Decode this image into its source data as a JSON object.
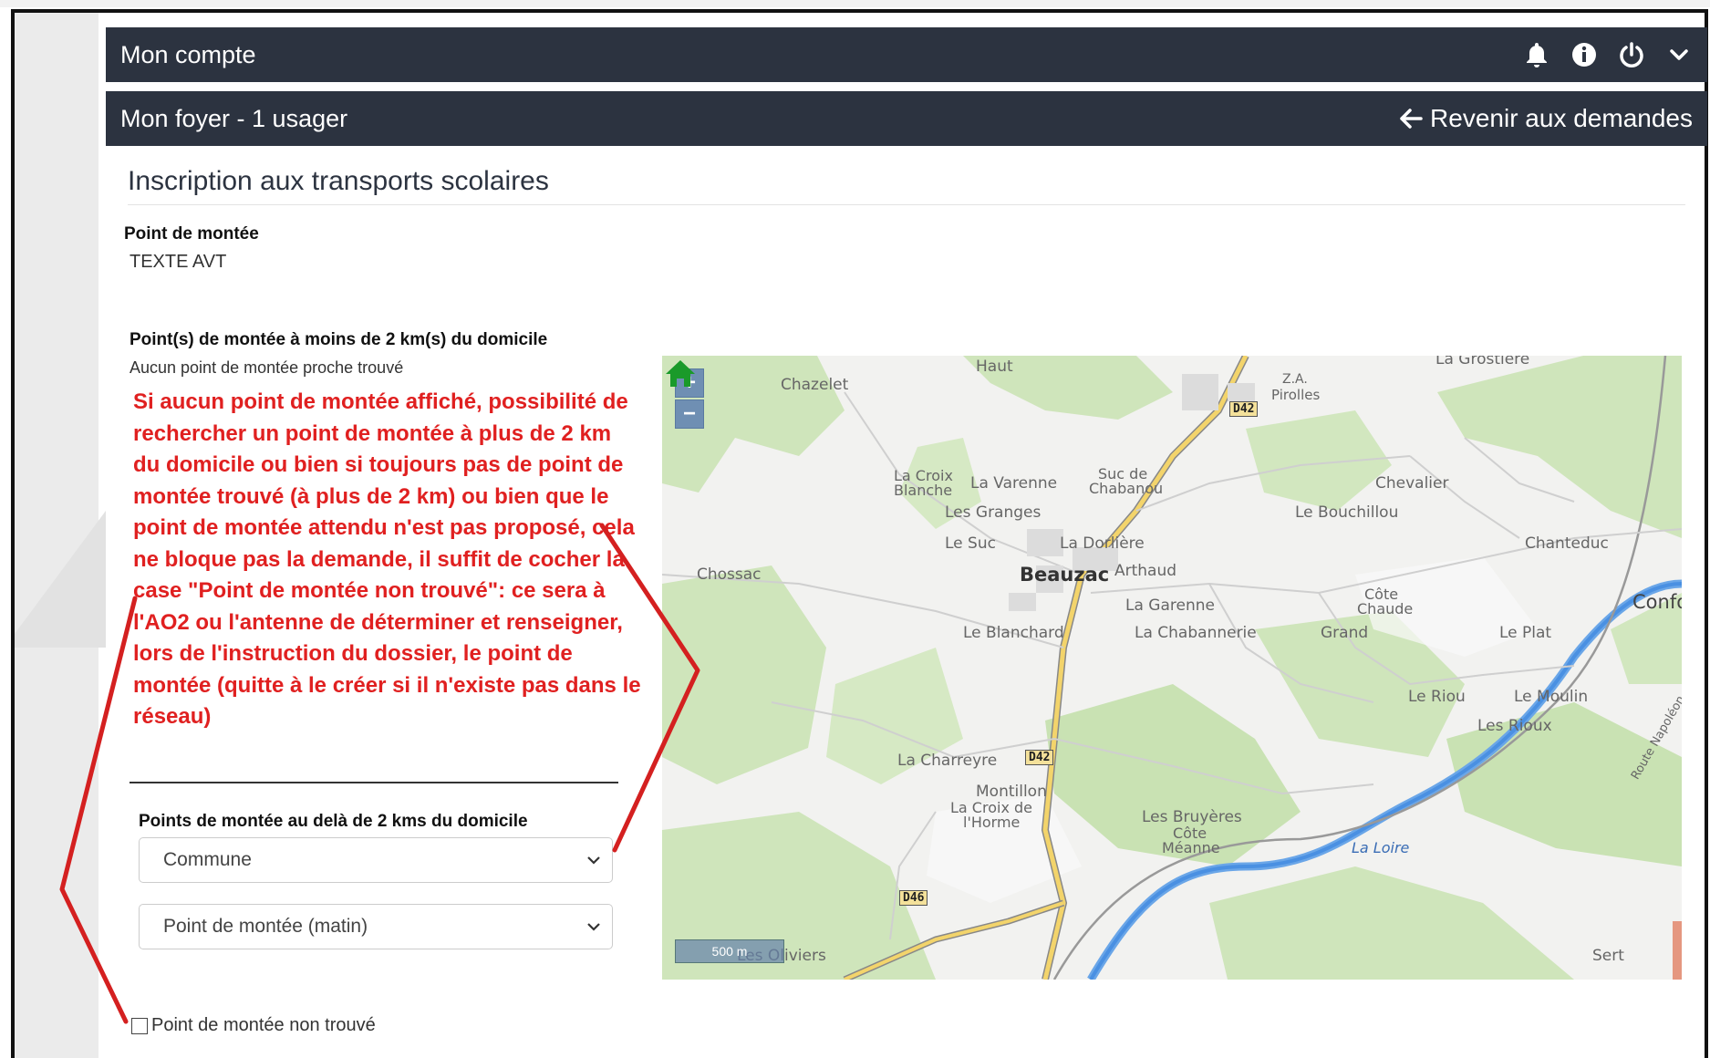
{
  "topbar": {
    "title": "Mon compte",
    "icons": [
      "bell-icon",
      "info-icon",
      "power-icon",
      "chevron-down-icon"
    ]
  },
  "subbar": {
    "title": "Mon foyer - 1 usager",
    "back_label": "Revenir aux demandes"
  },
  "page": {
    "heading": "Inscription aux transports scolaires",
    "pickup_label": "Point de montée",
    "pickup_value": "TEXTE AVT",
    "nearby_title": "Point(s) de montée à moins de 2 km(s) du domicile",
    "nearby_empty": "Aucun point de montée proche trouvé",
    "annotation": "Si aucun point de montée affiché, possibilité de rechercher un point de montée à plus de 2 km du domicile ou bien si toujours pas de point de montée trouvé (à plus de 2 km) ou bien que le point de montée attendu n'est pas proposé, cela ne bloque pas la demande, il suffit de cocher la case \"Point de montée non trouvé\": ce sera à l'AO2 ou l'antenne de déterminer et renseigner, lors de l'instruction du dossier, le point de montée (quitte à le créer si il n'existe pas dans le réseau)",
    "far_title": "Points de montée au delà de 2 kms du domicile",
    "select_commune": "Commune",
    "select_point": "Point de montée (matin)",
    "not_found_label": "Point de montée non trouvé"
  },
  "map": {
    "zoom_in": "+",
    "zoom_out": "−",
    "scale": "500 m",
    "places": {
      "haut": "Haut",
      "chazelet": "Chazelet",
      "grostiere": "La Grostière",
      "za": "Z.A.",
      "pirolles": "Pirolles",
      "croix1": "La Croix",
      "blanche": "Blanche",
      "varenne": "La Varenne",
      "suc": "Suc de",
      "chabanou": "Chabanou",
      "chevalier": "Chevalier",
      "granges": "Les Granges",
      "bouchillou": "Le Bouchillou",
      "lesuc": "Le Suc",
      "dorliere": "La Dorlière",
      "chanteduc": "Chanteduc",
      "chossac": "Chossac",
      "beauzac": "Beauzac",
      "arthaud": "Arthaud",
      "garenne": "La Garenne",
      "cote": "Côte",
      "chaude": "Chaude",
      "confo": "Confo",
      "blanchard": "Le Blanchard",
      "chabannerie": "La Chabannerie",
      "grand": "Grand",
      "plat": "Le Plat",
      "riou": "Le Riou",
      "moulin": "Le Moulin",
      "rioux": "Les Rioux",
      "charreyre": "La Charreyre",
      "montillon": "Montillon",
      "croixhorme": "La Croix de",
      "horme": "l'Horme",
      "bruyeres": "Les Bruyères",
      "cote2": "Côte",
      "meanne": "Méanne",
      "loire": "La Loire",
      "oliviers": "Les Oliviers",
      "sert": "Sert",
      "route": "Route Napoléon"
    },
    "roads": {
      "d42a": "D42",
      "d42b": "D42",
      "d46": "D46"
    }
  },
  "colors": {
    "header_bg": "#2c3340",
    "annotation": "#e02020",
    "map_green": "#c9e2b3",
    "river": "#4a90e2",
    "road": "#f3d46b"
  }
}
